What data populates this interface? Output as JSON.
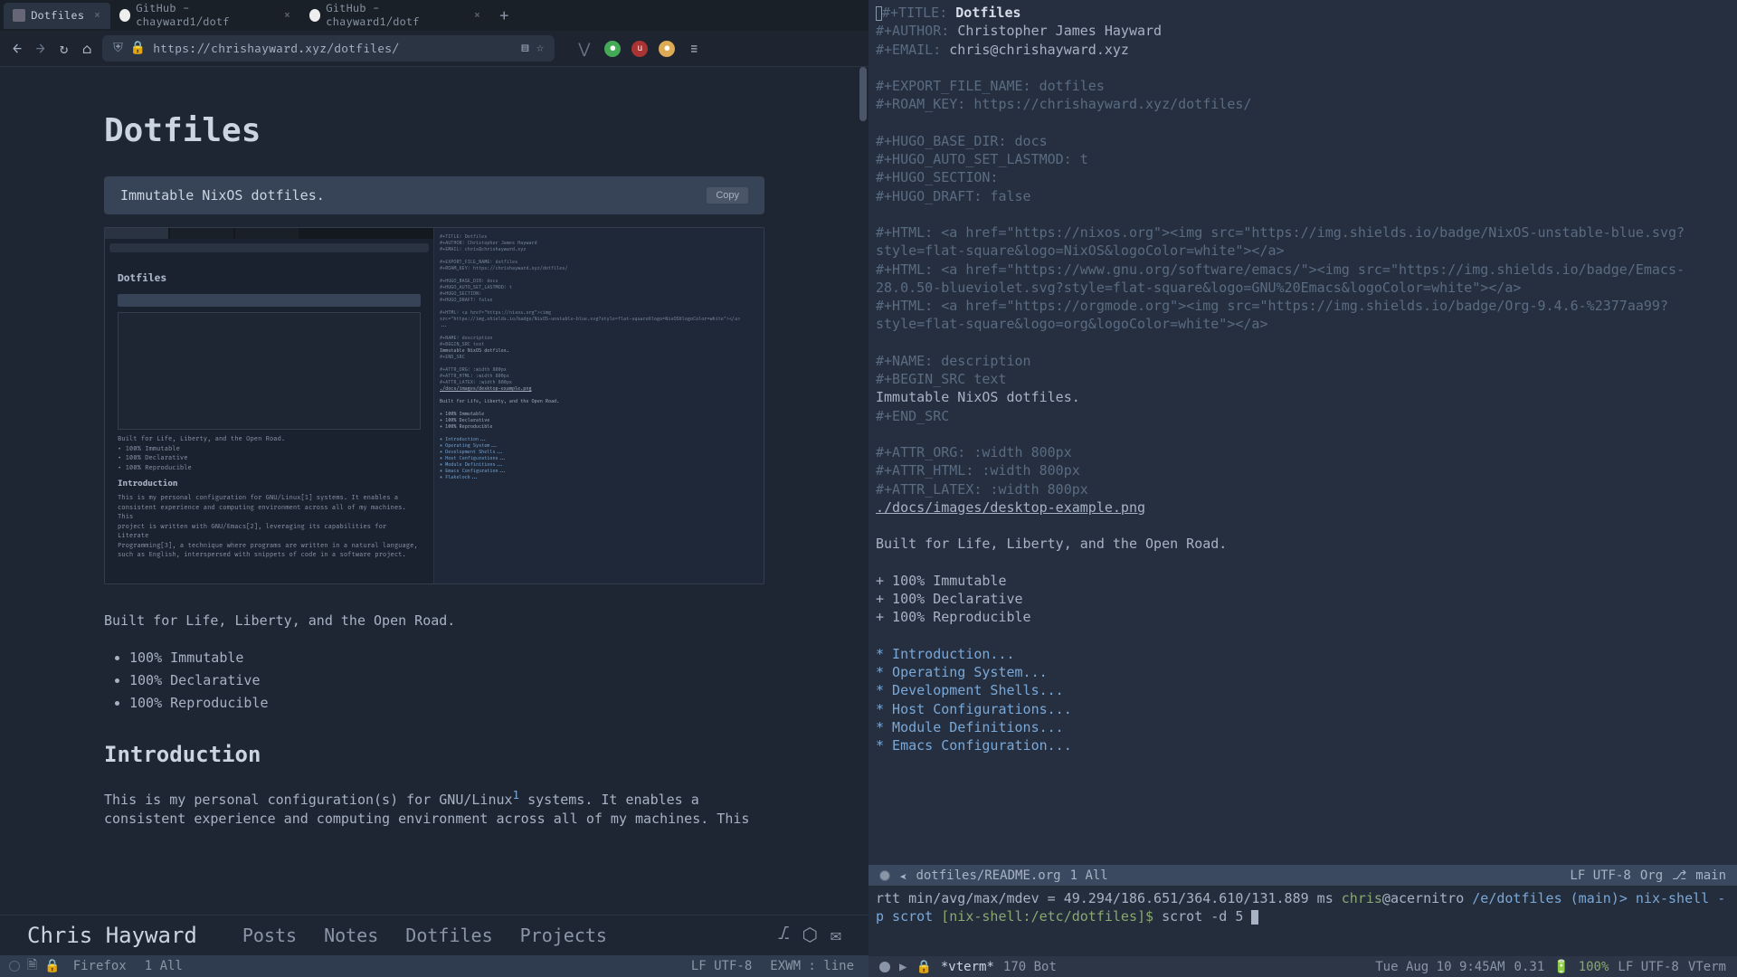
{
  "browser": {
    "tabs": [
      {
        "label": "Dotfiles",
        "active": true
      },
      {
        "label": "GitHub - chayward1/dotf",
        "active": false
      },
      {
        "label": "GitHub - chayward1/dotf",
        "active": false
      }
    ],
    "url": "https://chrishayward.xyz/dotfiles/"
  },
  "page": {
    "title": "Dotfiles",
    "code_desc": "Immutable NixOS dotfiles.",
    "copy_label": "Copy",
    "built_for": "Built for Life, Liberty, and the Open Road.",
    "bullets": [
      "100% Immutable",
      "100% Declarative",
      "100% Reproducible"
    ],
    "intro_heading": "Introduction",
    "intro_para": "This is my personal configuration(s) for GNU/Linux¹ systems. It enables a consistent experience and computing environment across all of my machines. This"
  },
  "site_nav": {
    "brand": "Chris Hayward",
    "links": [
      "Posts",
      "Notes",
      "Dotfiles",
      "Projects"
    ]
  },
  "left_status": {
    "buffer": "Firefox",
    "pos": "1 All",
    "encoding": "LF UTF-8",
    "mode": "EXWM : line"
  },
  "org": {
    "title_kw": "#+TITLE:",
    "title_val": "Dotfiles",
    "author_kw": "#+AUTHOR:",
    "author_val": "Christopher James Hayward",
    "email_kw": "#+EMAIL:",
    "email_val": "chris@chrishayward.xyz",
    "export_kw": "#+EXPORT_FILE_NAME: dotfiles",
    "roam_kw": "#+ROAM_KEY: https://chrishayward.xyz/dotfiles/",
    "hugo_base": "#+HUGO_BASE_DIR: docs",
    "hugo_lastmod": "#+HUGO_AUTO_SET_LASTMOD: t",
    "hugo_section": "#+HUGO_SECTION:",
    "hugo_draft": "#+HUGO_DRAFT: false",
    "html1": "#+HTML: <a href=\"https://nixos.org\"><img src=\"https://img.shields.io/badge/NixOS-unstable-blue.svg?style=flat-square&logo=NixOS&logoColor=white\"></a>",
    "html2": "#+HTML: <a href=\"https://www.gnu.org/software/emacs/\"><img src=\"https://img.shields.io/badge/Emacs-28.0.50-blueviolet.svg?style=flat-square&logo=GNU%20Emacs&logoColor=white\"></a>",
    "html3": "#+HTML: <a href=\"https://orgmode.org\"><img src=\"https://img.shields.io/badge/Org-9.4.6-%2377aa99?style=flat-square&logo=org&logoColor=white\"></a>",
    "name_kw": "#+NAME: description",
    "begin_src": "#+BEGIN_SRC text",
    "src_body": "Immutable NixOS dotfiles.",
    "end_src": "#+END_SRC",
    "attr_org": "#+ATTR_ORG: :width 800px",
    "attr_html": "#+ATTR_HTML: :width 800px",
    "attr_latex": "#+ATTR_LATEX: :width 800px",
    "img_link": "./docs/images/desktop-example.png",
    "built_for": "Built for Life, Liberty, and the Open Road.",
    "bullets": [
      "+ 100% Immutable",
      "+ 100% Declarative",
      "+ 100% Reproducible"
    ],
    "headings": [
      "* Introduction...",
      "* Operating System...",
      "* Development Shells...",
      "* Host Configurations...",
      "* Module Definitions...",
      "* Emacs Configuration..."
    ]
  },
  "org_modeline": {
    "path": "dotfiles/README.org",
    "pos": "1 All",
    "encoding": "LF UTF-8",
    "mode": "Org",
    "branch": "main"
  },
  "vterm": {
    "rtt": "rtt min/avg/max/mdev = 49.294/186.651/364.610/131.889 ms",
    "prompt_user": "chris",
    "prompt_at": "@acernitro",
    "prompt_path": "/e/dotfiles",
    "prompt_branch": "(main)>",
    "prev_cmd": "nix-shell -p scrot",
    "nix_prompt": "[nix-shell:/etc/dotfiles]$",
    "cmd": "scrot -d 5"
  },
  "vterm_modeline": {
    "buffer": "*vterm*",
    "pos": "170 Bot",
    "datetime": "Tue Aug 10 9:45AM",
    "load": "0.31",
    "battery": "100%",
    "encoding": "LF UTF-8",
    "mode": "VTerm"
  },
  "mini": {
    "title": "Dotfiles",
    "intro": "Introduction",
    "built": "Built for Life, Liberty, and the Open Road."
  }
}
